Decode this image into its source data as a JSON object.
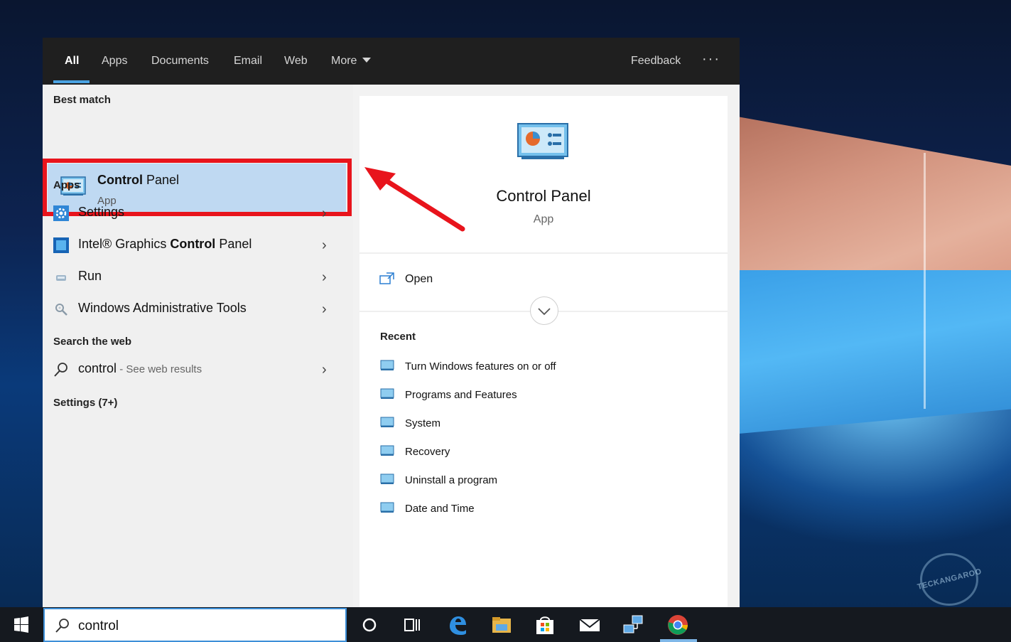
{
  "tabs": [
    {
      "label": "All",
      "active": true
    },
    {
      "label": "Apps"
    },
    {
      "label": "Documents"
    },
    {
      "label": "Email"
    },
    {
      "label": "Web"
    },
    {
      "label": "More"
    }
  ],
  "header": {
    "feedback": "Feedback",
    "ellipsis": "···"
  },
  "best_match": {
    "section": "Best match",
    "title_bold": "Control",
    "title_rest": " Panel",
    "subtitle": "App"
  },
  "apps": {
    "section": "Apps",
    "items": [
      {
        "label": "Settings",
        "icon": "settings-gear-icon"
      },
      {
        "label_pre": "Intel® Graphics ",
        "label_bold": "Control",
        "label_post": " Panel",
        "icon": "intel-graphics-icon"
      },
      {
        "label": "Run",
        "icon": "run-icon"
      },
      {
        "label": "Windows Administrative Tools",
        "icon": "admin-tools-icon"
      }
    ]
  },
  "web": {
    "section": "Search the web",
    "query": "control",
    "suffix": " - See web results"
  },
  "settings_section": "Settings (7+)",
  "preview": {
    "title": "Control Panel",
    "subtitle": "App",
    "open": "Open",
    "recent_label": "Recent",
    "recent": [
      "Turn Windows features on or off",
      "Programs and Features",
      "System",
      "Recovery",
      "Uninstall a program",
      "Date and Time"
    ]
  },
  "taskbar": {
    "search_value": "control",
    "icons": [
      "windows-start-icon",
      "cortana-circle-icon",
      "task-view-icon",
      "edge-icon",
      "file-explorer-icon",
      "store-icon",
      "mail-icon",
      "network-icon",
      "chrome-icon"
    ]
  },
  "watermark": "TECKANGAROO",
  "colors": {
    "highlight": "#bfd9f2",
    "annotation_red": "#e8141c",
    "accent_blue": "#4aa3e3"
  }
}
